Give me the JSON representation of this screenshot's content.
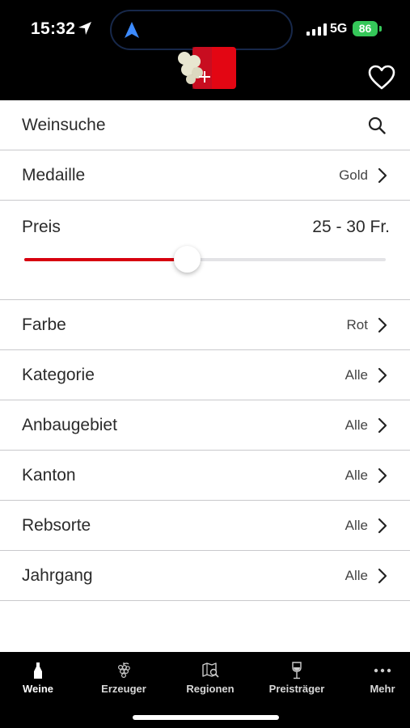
{
  "status": {
    "time": "15:32",
    "network": "5G",
    "battery": "86"
  },
  "header": {
    "logo": "swiss-wine-logo",
    "favorite_icon": "heart-icon"
  },
  "search": {
    "label": "Weinsuche",
    "icon": "search-icon"
  },
  "filters": [
    {
      "key": "medaille",
      "label": "Medaille",
      "value": "Gold"
    },
    {
      "key": "farbe",
      "label": "Farbe",
      "value": "Rot"
    },
    {
      "key": "kategorie",
      "label": "Kategorie",
      "value": "Alle"
    },
    {
      "key": "anbaugebiet",
      "label": "Anbaugebiet",
      "value": "Alle"
    },
    {
      "key": "kanton",
      "label": "Kanton",
      "value": "Alle"
    },
    {
      "key": "rebsorte",
      "label": "Rebsorte",
      "value": "Alle"
    },
    {
      "key": "jahrgang",
      "label": "Jahrgang",
      "value": "Alle"
    }
  ],
  "price": {
    "label": "Preis",
    "range_text": "25 - 30 Fr.",
    "slider_fraction": 0.45
  },
  "tabs": [
    {
      "label": "Weine",
      "icon": "bottle-icon",
      "active": true
    },
    {
      "label": "Erzeuger",
      "icon": "grapes-icon",
      "active": false
    },
    {
      "label": "Regionen",
      "icon": "map-icon",
      "active": false
    },
    {
      "label": "Preisträger",
      "icon": "wine-glass-icon",
      "active": false
    },
    {
      "label": "Mehr",
      "icon": "more-icon",
      "active": false
    }
  ],
  "colors": {
    "accent": "#d7000f",
    "battery": "#35c759",
    "track": "#e3e3e6"
  }
}
